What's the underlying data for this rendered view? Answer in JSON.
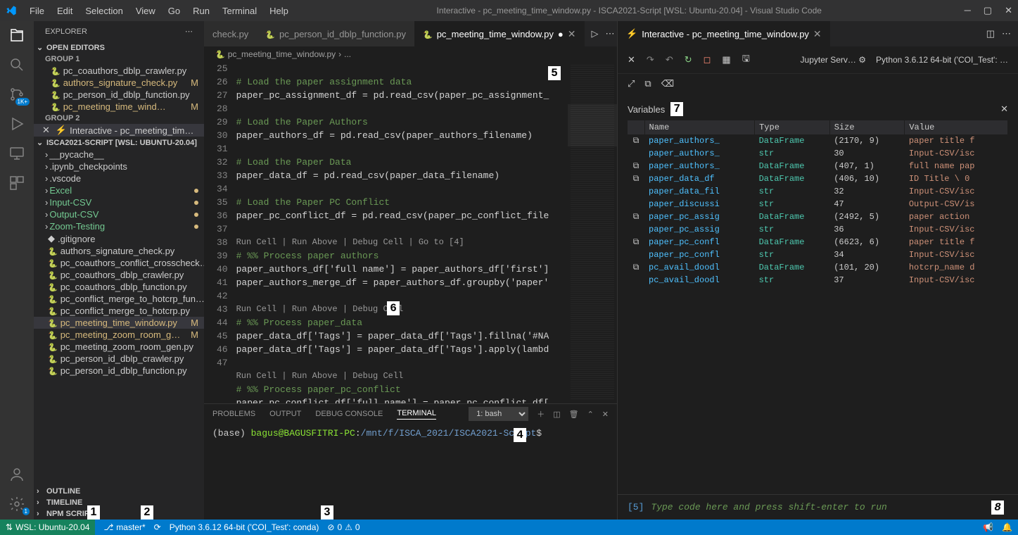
{
  "titlebar": {
    "menus": [
      "File",
      "Edit",
      "Selection",
      "View",
      "Go",
      "Run",
      "Terminal",
      "Help"
    ],
    "title": "Interactive - pc_meeting_time_window.py - ISCA2021-Script [WSL: Ubuntu-20.04] - Visual Studio Code"
  },
  "sidebar": {
    "title": "EXPLORER",
    "open_editors_label": "OPEN EDITORS",
    "group1": "GROUP 1",
    "group2": "GROUP 2",
    "open_editors_g1": [
      "pc_coauthors_dblp_crawler.py",
      "authors_signature_check.py",
      "pc_person_id_dblp_function.py",
      "pc_meeting_time_wind…"
    ],
    "open_editors_g1_mod": [
      false,
      true,
      false,
      true
    ],
    "open_editors_g2": "Interactive - pc_meeting_tim…",
    "workspace": "ISCA2021-SCRIPT [WSL: UBUNTU-20.04]",
    "folders": [
      "__pycache__",
      ".ipynb_checkpoints",
      ".vscode"
    ],
    "green_folders": [
      "Excel",
      "Input-CSV",
      "Output-CSV",
      "Zoom-Testing"
    ],
    "gitignore": ".gitignore",
    "files": [
      "authors_signature_check.py",
      "pc_coauthors_conflict_crosscheck…",
      "pc_coauthors_dblp_crawler.py",
      "pc_coauthors_dblp_function.py",
      "pc_conflict_merge_to_hotcrp_fun…",
      "pc_conflict_merge_to_hotcrp.py",
      "pc_meeting_time_window.py",
      "pc_meeting_zoom_room_g…",
      "pc_meeting_zoom_room_gen.py",
      "pc_person_id_dblp_crawler.py",
      "pc_person_id_dblp_function.py"
    ],
    "files_mod": [
      false,
      false,
      false,
      false,
      false,
      false,
      true,
      true,
      false,
      false,
      false
    ],
    "outline": "OUTLINE",
    "timeline": "TIMELINE",
    "npm": "NPM SCRIPTS"
  },
  "editor_tabs": {
    "t1": "check.py",
    "t2": "pc_person_id_dblp_function.py",
    "t3": "pc_meeting_time_window.py"
  },
  "breadcrumb": {
    "file": "pc_meeting_time_window.py",
    "sep": "›",
    "more": "..."
  },
  "code": {
    "line_start": 25,
    "lines": [
      {
        "n": 25,
        "t": ""
      },
      {
        "n": 26,
        "t": "# Load the paper assignment data",
        "cls": "c"
      },
      {
        "n": 27,
        "t": "paper_pc_assignment_df = pd.read_csv(paper_pc_assignment_"
      },
      {
        "n": 28,
        "t": ""
      },
      {
        "n": 29,
        "t": "# Load the Paper Authors",
        "cls": "c"
      },
      {
        "n": 30,
        "t": "paper_authors_df = pd.read_csv(paper_authors_filename)"
      },
      {
        "n": 31,
        "t": ""
      },
      {
        "n": 32,
        "t": "# Load the Paper Data",
        "cls": "c"
      },
      {
        "n": 33,
        "t": "paper_data_df = pd.read_csv(paper_data_filename)"
      },
      {
        "n": 34,
        "t": ""
      },
      {
        "n": 35,
        "t": "# Load the Paper PC Conflict",
        "cls": "c"
      },
      {
        "n": 36,
        "t": "paper_pc_conflict_df = pd.read_csv(paper_pc_conflict_file"
      },
      {
        "n": 37,
        "t": ""
      },
      {
        "n": "",
        "t": "Run Cell | Run Above | Debug Cell | Go to [4]",
        "cls": "codelens"
      },
      {
        "n": 38,
        "t": "# %% Process paper authors",
        "cls": "c"
      },
      {
        "n": 39,
        "t": "paper_authors_df['full name'] = paper_authors_df['first']"
      },
      {
        "n": 40,
        "t": "paper_authors_merge_df = paper_authors_df.groupby('paper'"
      },
      {
        "n": 41,
        "t": ""
      },
      {
        "n": "",
        "t": "Run Cell | Run Above | Debug Cell",
        "cls": "codelens"
      },
      {
        "n": 42,
        "t": "# %% Process paper_data",
        "cls": "c"
      },
      {
        "n": 43,
        "t": "paper_data_df['Tags'] = paper_data_df['Tags'].fillna('#NA"
      },
      {
        "n": 44,
        "t": "paper_data_df['Tags'] = paper_data_df['Tags'].apply(lambd"
      },
      {
        "n": 45,
        "t": ""
      },
      {
        "n": "",
        "t": "Run Cell | Run Above | Debug Cell",
        "cls": "codelens"
      },
      {
        "n": 46,
        "t": "# %% Process paper_pc_conflict",
        "cls": "c"
      },
      {
        "n": 47,
        "t": "paper_pc_conflict_df['full name'] = paper_pc_conflict_df["
      }
    ]
  },
  "interactive": {
    "title": "Interactive - pc_meeting_time_window.py",
    "server": "Jupyter Serv…",
    "kernel": "Python 3.6.12 64-bit ('COI_Test': …",
    "variables_label": "Variables",
    "headers": {
      "name": "Name",
      "type": "Type",
      "size": "Size",
      "value": "Value"
    },
    "vars": [
      {
        "ic": true,
        "name": "paper_authors_",
        "type": "DataFrame",
        "size": "(2170, 9)",
        "val": "paper title f"
      },
      {
        "ic": false,
        "name": "paper_authors_",
        "type": "str",
        "size": "30",
        "val": "Input-CSV/isc"
      },
      {
        "ic": true,
        "name": "paper_authors_",
        "type": "DataFrame",
        "size": "(407, 1)",
        "val": "full name pap"
      },
      {
        "ic": true,
        "name": "paper_data_df",
        "type": "DataFrame",
        "size": "(406, 10)",
        "val": "ID Title \\ 0"
      },
      {
        "ic": false,
        "name": "paper_data_fil",
        "type": "str",
        "size": "32",
        "val": "Input-CSV/isc"
      },
      {
        "ic": false,
        "name": "paper_discussi",
        "type": "str",
        "size": "47",
        "val": "Output-CSV/is"
      },
      {
        "ic": true,
        "name": "paper_pc_assig",
        "type": "DataFrame",
        "size": "(2492, 5)",
        "val": "paper action"
      },
      {
        "ic": false,
        "name": "paper_pc_assig",
        "type": "str",
        "size": "36",
        "val": "Input-CSV/isc"
      },
      {
        "ic": true,
        "name": "paper_pc_confl",
        "type": "DataFrame",
        "size": "(6623, 6)",
        "val": "paper title f"
      },
      {
        "ic": false,
        "name": "paper_pc_confl",
        "type": "str",
        "size": "34",
        "val": "Input-CSV/isc"
      },
      {
        "ic": true,
        "name": "pc_avail_doodl",
        "type": "DataFrame",
        "size": "(101, 20)",
        "val": "hotcrp_name d"
      },
      {
        "ic": false,
        "name": "pc_avail_doodl",
        "type": "str",
        "size": "37",
        "val": "Input-CSV/isc"
      }
    ],
    "input_num": "[5]",
    "input_placeholder": "Type code here and press shift-enter to run"
  },
  "terminal": {
    "tabs": [
      "PROBLEMS",
      "OUTPUT",
      "DEBUG CONSOLE",
      "TERMINAL"
    ],
    "shell": "1: bash",
    "base": "(base) ",
    "user": "bagus@BAGUSFITRI-PC",
    "colon": ":",
    "path": "/mnt/f/ISCA_2021/ISCA2021-Script",
    "prompt": "$"
  },
  "statusbar": {
    "remote": "WSL: Ubuntu-20.04",
    "branch": "master*",
    "python": "Python 3.6.12 64-bit ('COI_Test': conda)",
    "errors": "0",
    "warnings": "0"
  },
  "activity_badge": "1K+",
  "settings_badge": "1",
  "callouts": {
    "1": "1",
    "2": "2",
    "3": "3",
    "4": "4",
    "5": "5",
    "6": "6",
    "7": "7",
    "8": "8"
  }
}
